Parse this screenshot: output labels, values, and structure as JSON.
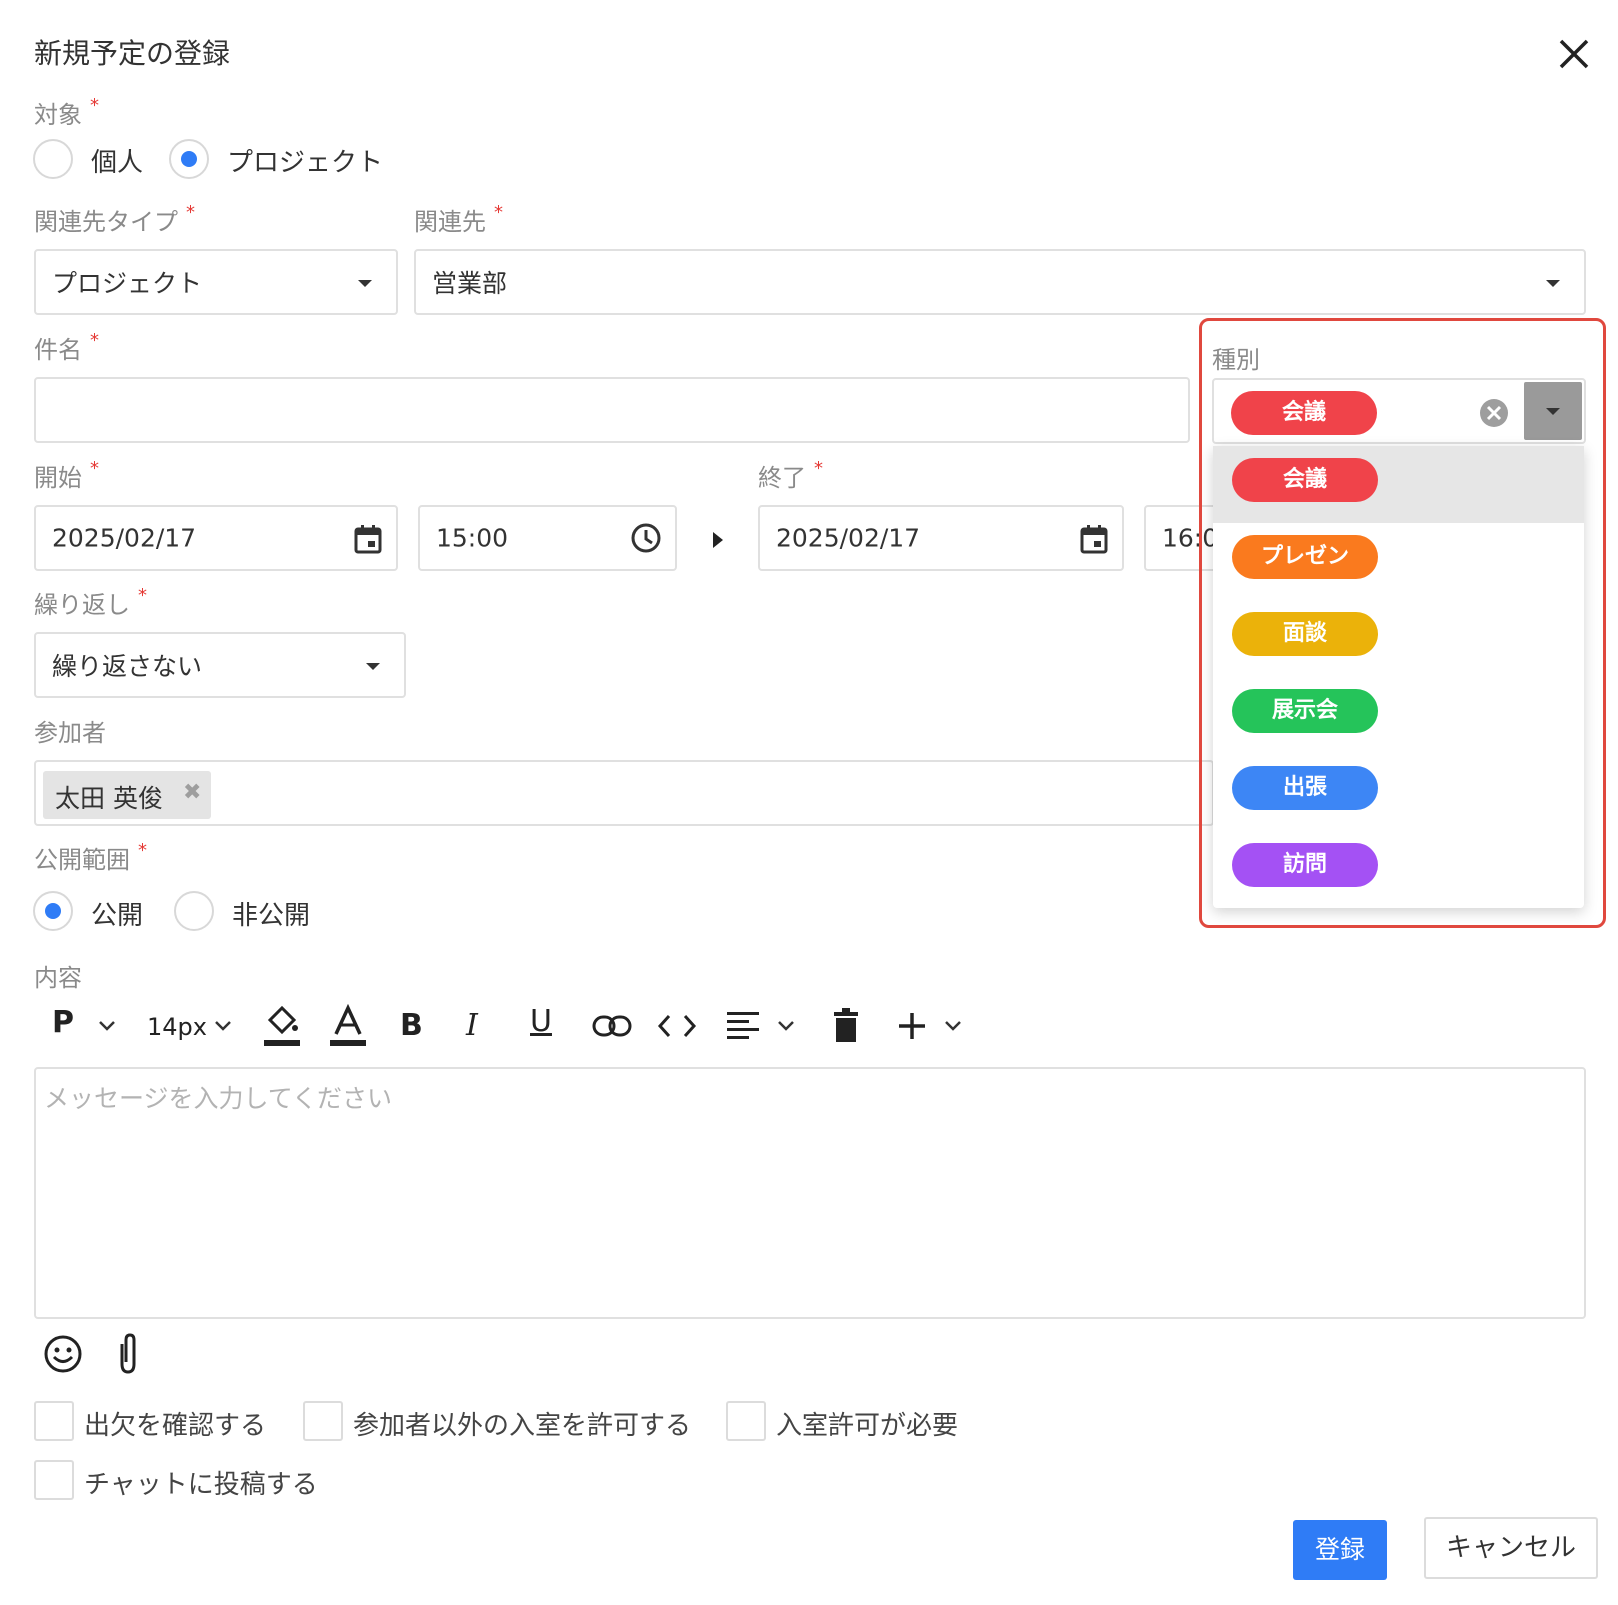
{
  "dialog": {
    "title": "新規予定の登録"
  },
  "target": {
    "label": "対象",
    "options": [
      "個人",
      "プロジェクト"
    ],
    "selected": "プロジェクト"
  },
  "relation_type": {
    "label": "関連先タイプ",
    "value": "プロジェクト"
  },
  "relation": {
    "label": "関連先",
    "value": "営業部"
  },
  "subject": {
    "label": "件名",
    "value": ""
  },
  "start": {
    "label": "開始",
    "date": "2025/02/17",
    "time": "15:00"
  },
  "end": {
    "label": "終了",
    "date": "2025/02/17",
    "time": "16:0"
  },
  "category": {
    "label": "種別",
    "selected": "会議",
    "selected_color": "#f0434a",
    "options": [
      {
        "label": "会議",
        "color": "#f0434a"
      },
      {
        "label": "プレゼン",
        "color": "#fa7a1e"
      },
      {
        "label": "面談",
        "color": "#ebb20a"
      },
      {
        "label": "展示会",
        "color": "#25c45a"
      },
      {
        "label": "出張",
        "color": "#3d86f5"
      },
      {
        "label": "訪問",
        "color": "#a451f4"
      }
    ]
  },
  "repeat": {
    "label": "繰り返し",
    "value": "繰り返さない"
  },
  "participants": {
    "label": "参加者",
    "chips": [
      "太田 英俊"
    ]
  },
  "visibility": {
    "label": "公開範囲",
    "options": [
      "公開",
      "非公開"
    ],
    "selected": "公開"
  },
  "content": {
    "label": "内容",
    "toolbar": {
      "block": "P",
      "font_size": "14px"
    },
    "placeholder": "メッセージを入力してください"
  },
  "checkboxes": [
    "出欠を確認する",
    "参加者以外の入室を許可する",
    "入室許可が必要",
    "チャットに投稿する"
  ],
  "buttons": {
    "submit": "登録",
    "cancel": "キャンセル"
  },
  "colors": {
    "primary": "#2f7cf6",
    "required": "#e53935",
    "highlight": "#e0483e"
  }
}
